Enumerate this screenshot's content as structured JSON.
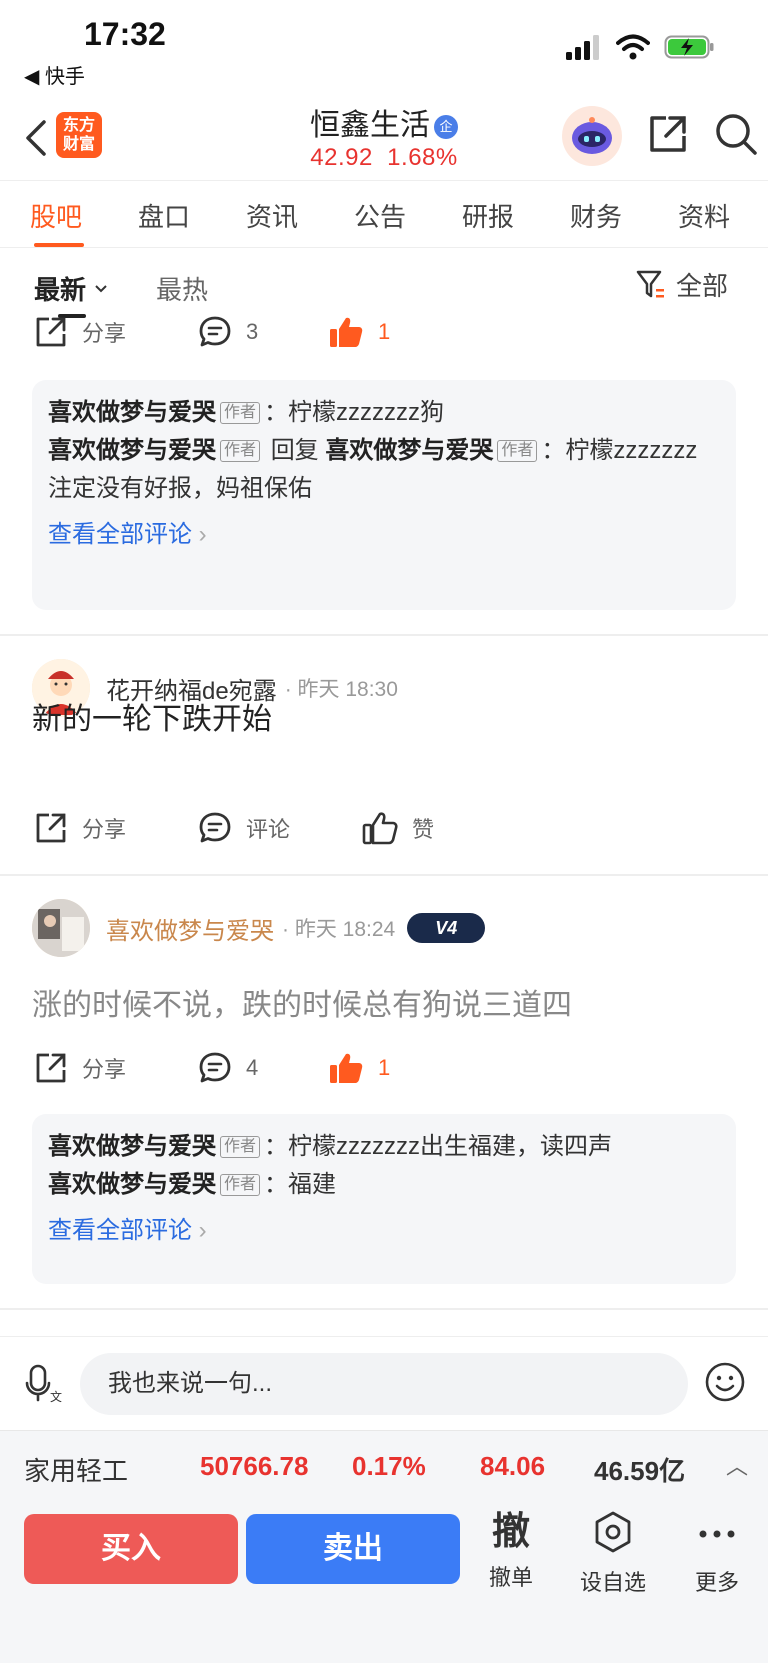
{
  "status_bar": {
    "time": "17:32",
    "back_app": "◀ 快手"
  },
  "header": {
    "logo_line1": "东方",
    "logo_line2": "财富",
    "stock_name": "恒鑫生活",
    "badge": "企",
    "price": "42.92",
    "change_pct": "1.68%"
  },
  "tabs": [
    "股吧",
    "盘口",
    "资讯",
    "公告",
    "研报",
    "财务",
    "资料"
  ],
  "sort": {
    "latest": "最新",
    "hot": "最热",
    "filter": "全部"
  },
  "post1": {
    "share": "分享",
    "comments": "3",
    "likes": "1",
    "replies": [
      {
        "author": "喜欢做梦与爱哭",
        "tag": "作者",
        "text": "：柠檬zzzzzzz狗"
      },
      {
        "author": "喜欢做梦与爱哭",
        "tag": "作者",
        "reply_word": "回复",
        "to": "喜欢做梦与爱哭",
        "tag2": "作者",
        "text": "：柠檬zzzzzzz注定没有好报，妈祖保佑"
      }
    ],
    "view_all": "查看全部评论"
  },
  "post2": {
    "username": "花开纳福de宛露",
    "time": "· 昨天 18:30",
    "text": "新的一轮下跌开始",
    "share": "分享",
    "comment": "评论",
    "like": "赞"
  },
  "post3": {
    "username": "喜欢做梦与爱哭",
    "time": "· 昨天 18:24",
    "level": "V4",
    "text": "涨的时候不说，跌的时候总有狗说三道四",
    "share": "分享",
    "comments": "4",
    "likes": "1",
    "replies": [
      {
        "author": "喜欢做梦与爱哭",
        "tag": "作者",
        "text": "：柠檬zzzzzzz出生福建，读四声"
      },
      {
        "author": "喜欢做梦与爱哭",
        "tag": "作者",
        "text": "：福建"
      }
    ],
    "view_all": "查看全部评论"
  },
  "comment_bar": {
    "placeholder": "我也来说一句..."
  },
  "sector": {
    "name": "家用轻工",
    "index": "50766.78",
    "pct": "0.17%",
    "change": "84.06",
    "volume": "46.59亿"
  },
  "trade": {
    "buy": "买入",
    "sell": "卖出",
    "cancel_big": "撤",
    "cancel": "撤单",
    "watch": "设自选",
    "more": "更多"
  },
  "colors": {
    "accent": "#ff5a1f",
    "up_red": "#e8332f",
    "link_blue": "#2a6be0",
    "sell_blue": "#3b7cf6",
    "buy_red": "#ee5a57"
  }
}
